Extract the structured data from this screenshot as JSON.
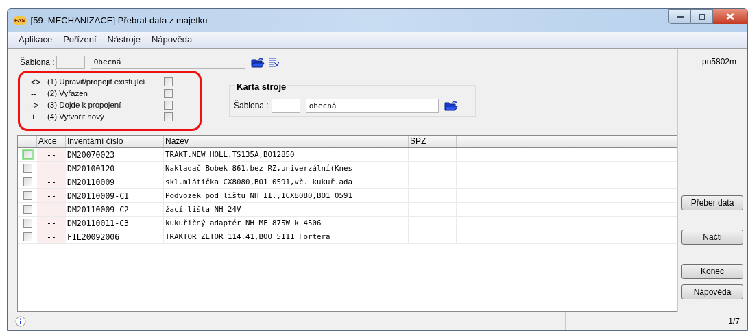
{
  "window": {
    "app_icon": "FAS",
    "title": "[59_MECHANIZACE] Přebrat data z majetku"
  },
  "menu": [
    "Aplikace",
    "Pořízení",
    "Nástroje",
    "Nápověda"
  ],
  "template": {
    "label": "Šablona :",
    "code": "–",
    "name": "Obecná"
  },
  "legend": [
    {
      "symbol": "<>",
      "label": "(1) Upravit/propojit existující",
      "checked": false
    },
    {
      "symbol": "--",
      "label": "(2) Vyřazen",
      "checked": false
    },
    {
      "symbol": "->",
      "label": "(3) Dojde k propojení",
      "checked": false
    },
    {
      "symbol": "+",
      "label": "(4) Vytvořit nový",
      "checked": false
    }
  ],
  "machine_card": {
    "title": "Karta stroje",
    "label": "Šablona :",
    "code": "–",
    "name": "obecná"
  },
  "user_code": "pn5802m",
  "table": {
    "columns": [
      "Akce",
      "Inventární číslo",
      "Název",
      "SPZ"
    ],
    "rows": [
      {
        "checked": false,
        "focused": true,
        "akce": "--",
        "inv": "DM20070023",
        "name": "TRAKT.NEW HOLL.TS135A,BO12850"
      },
      {
        "checked": false,
        "focused": false,
        "akce": "--",
        "inv": "DM20100120",
        "name": "Nakladač Bobek 861,bez RZ,univerzální(Knes"
      },
      {
        "checked": false,
        "focused": false,
        "akce": "--",
        "inv": "DM20110009",
        "name": "skl.mlátička CX8080,BO1 0591,vč. kukuř.ada"
      },
      {
        "checked": false,
        "focused": false,
        "akce": "--",
        "inv": "DM20110009-C1",
        "name": "Podvozek pod lištu NH II.,1CX8080,BO1 0591"
      },
      {
        "checked": false,
        "focused": false,
        "akce": "--",
        "inv": "DM20110009-C2",
        "name": "žací lišta NH 24V"
      },
      {
        "checked": false,
        "focused": false,
        "akce": "--",
        "inv": "DM20110011-C3",
        "name": "kukuřičný adaptér NH MF 875W k 4506"
      },
      {
        "checked": false,
        "focused": false,
        "akce": "--",
        "inv": "FIL20092006",
        "name": "TRAKTOR ZETOR 114.41,BOO 5111 Fortera"
      }
    ]
  },
  "buttons": [
    "Přeber data",
    "Načti",
    "Konec",
    "Nápověda"
  ],
  "status_bar": {
    "counter": "1/7"
  }
}
